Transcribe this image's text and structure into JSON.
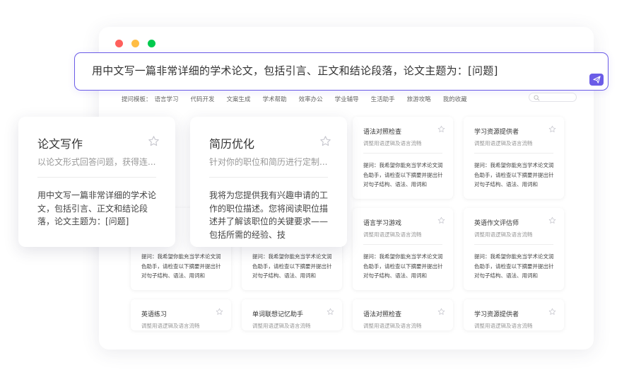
{
  "prompt": {
    "text": "用中文写一篇非常详细的学术论文，包括引言、正文和结论段落，论文主题为：[问题]"
  },
  "templates_bar": {
    "lead": "提问模板：",
    "tags": [
      "语言学习",
      "代码开发",
      "文案生成",
      "学术帮助",
      "效率办公",
      "学业辅导",
      "生活助手",
      "旅游攻略",
      "我的收藏"
    ]
  },
  "featured_cards": [
    {
      "title": "论文写作",
      "subtitle": "以论文形式回答问题，获得连...",
      "body": "用中文写一篇非常详细的学术论文，包括引言、正文和结论段落，论文主题为：[问题]"
    },
    {
      "title": "简历优化",
      "subtitle": "针对你的职位和简历进行定制...",
      "body": "我将为您提供我有兴趣申请的工作的职位描述。您将阅读职位描述并了解该职位的关键要求——包括所需的经验、技"
    }
  ],
  "cards": [
    {
      "title": "语法对照检查",
      "subtitle": "调整用语逻辑及语言流畅",
      "body": "提问：我希望你能充当学术论文润色助手，请检查以下摘要并提出针对句子结构、语法、用词和"
    },
    {
      "title": "学习资源提供者",
      "subtitle": "调整用语逻辑及语言流畅",
      "body": "提问：我希望你能充当学术论文润色助手，请检查以下摘要并提出针对句子结构、语法、用词和"
    },
    {
      "title": "语言学习游戏",
      "subtitle": "调整用语逻辑及语言流畅",
      "body": "提问：我希望你能充当学术论文润色助手，请检查以下摘要并提出针对句子结构、语法、用词和"
    },
    {
      "title": "英语作文评估师",
      "subtitle": "调整用语逻辑及语言流畅",
      "body": "提问：我希望你能充当学术论文润色助手，请检查以下摘要并提出针对句子结构、语法、用词和"
    },
    {
      "body": "提问：我希望你能充当学术论文润色助手，请检查以下摘要并提出针对句子结构、语法、用词和"
    },
    {
      "body": "提问：我希望你能充当学术论文润色助手，请检查以下摘要并提出针对句子结构、语法、用词和"
    },
    {
      "title": "英语练习",
      "subtitle": "调整用语逻辑及语言流畅"
    },
    {
      "title": "单词联想记忆助手",
      "subtitle": "调整用语逻辑及语言流畅"
    },
    {
      "title": "语法对照检查",
      "subtitle": "调整用语逻辑及语言流畅"
    },
    {
      "title": "学习资源提供者",
      "subtitle": "调整用语逻辑及语言流畅"
    }
  ],
  "colors": {
    "accent": "#6b5ce7",
    "star": "#c4c4cc",
    "dot_red": "#ff605c",
    "dot_yellow": "#ffbd44",
    "dot_green": "#00ca4e"
  },
  "icons": {
    "send": "send-icon",
    "star": "star-icon",
    "search": "search-icon"
  }
}
